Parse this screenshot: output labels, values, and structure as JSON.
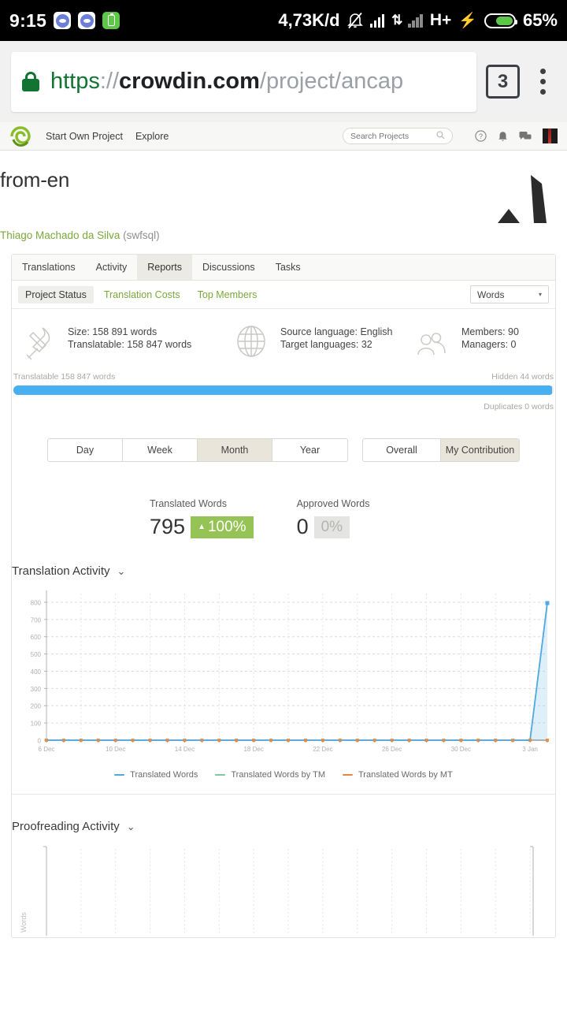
{
  "statusbar": {
    "clock": "9:15",
    "app_icons": [
      "discord-icon",
      "discord-icon",
      "battery-app-icon"
    ],
    "data_speed": "4,73K/d",
    "network_type": "H+",
    "battery_percent": "65%",
    "battery_level": 65,
    "icons": [
      "bell-muted-icon",
      "signal-icon",
      "data-transfer-icon",
      "signal-icon",
      "charging-bolt-icon"
    ]
  },
  "browser": {
    "url": {
      "scheme": "https",
      "separator": "://",
      "host": "crowdin.com",
      "path": "/project/ancap"
    },
    "lock_icon": "lock-icon",
    "tab_count": "3",
    "menu_icon": "kebab-menu-icon"
  },
  "site_header": {
    "logo": "crowdin-logo",
    "links": [
      {
        "label": "Start Own Project"
      },
      {
        "label": "Explore"
      }
    ],
    "search": {
      "placeholder": "Search Projects",
      "value": "",
      "icon": "search-icon"
    },
    "icons": [
      "help-icon",
      "bell-icon",
      "chat-icon",
      "avatar"
    ]
  },
  "project": {
    "title": "from-en",
    "owner_name": "Thiago Machado da Silva",
    "owner_handle": "(swfsql)",
    "logo": "project-logo-a"
  },
  "tabs": [
    {
      "label": "Translations",
      "active": false
    },
    {
      "label": "Activity",
      "active": false
    },
    {
      "label": "Reports",
      "active": true
    },
    {
      "label": "Discussions",
      "active": false
    },
    {
      "label": "Tasks",
      "active": false
    }
  ],
  "subtabs": [
    {
      "label": "Project Status",
      "active": true
    },
    {
      "label": "Translation Costs",
      "active": false
    },
    {
      "label": "Top Members",
      "active": false
    }
  ],
  "unit_select": {
    "value": "Words",
    "caret": "▾"
  },
  "stats": [
    {
      "icon": "tools-icon",
      "lines": [
        "Size: 158 891 words",
        "Translatable: 158 847 words"
      ]
    },
    {
      "icon": "globe-icon",
      "lines": [
        "Source language: English",
        "Target languages: 32"
      ]
    },
    {
      "icon": "members-icon",
      "lines": [
        "Members: 90",
        "Managers: 0"
      ]
    }
  ],
  "progress": {
    "left_label": "Translatable 158 847 words",
    "right_label": "Hidden 44 words",
    "percent": 99.7,
    "fill_color": "#46b0f0",
    "track_color": "#e9e9e6",
    "duplicates_label": "Duplicates 0 words"
  },
  "period_toggle": [
    {
      "label": "Day",
      "active": false
    },
    {
      "label": "Week",
      "active": false
    },
    {
      "label": "Month",
      "active": true
    },
    {
      "label": "Year",
      "active": false
    }
  ],
  "scope_toggle": [
    {
      "label": "Overall",
      "active": false
    },
    {
      "label": "My Contribution",
      "active": true
    }
  ],
  "metrics": [
    {
      "label": "Translated Words",
      "value": "795",
      "delta": "100%",
      "delta_state": "up",
      "triangle": "▲"
    },
    {
      "label": "Approved Words",
      "value": "0",
      "delta": "0%",
      "delta_state": "zero",
      "triangle": ""
    }
  ],
  "chart_data": [
    {
      "type": "area",
      "title": "Translation Activity",
      "collapse_icon": "chevron-down-icon",
      "xlabel": "",
      "ylabel": "",
      "ylim": [
        0,
        850
      ],
      "yticks": [
        0,
        100,
        200,
        300,
        400,
        500,
        600,
        700,
        800
      ],
      "grid": true,
      "legend_position": "bottom",
      "xtick_labels": [
        "6 Dec",
        "10 Dec",
        "14 Dec",
        "18 Dec",
        "22 Dec",
        "26 Dec",
        "30 Dec",
        "3 Jan"
      ],
      "x": [
        "6 Dec",
        "7 Dec",
        "8 Dec",
        "9 Dec",
        "10 Dec",
        "11 Dec",
        "12 Dec",
        "13 Dec",
        "14 Dec",
        "15 Dec",
        "16 Dec",
        "17 Dec",
        "18 Dec",
        "19 Dec",
        "20 Dec",
        "21 Dec",
        "22 Dec",
        "23 Dec",
        "24 Dec",
        "25 Dec",
        "26 Dec",
        "27 Dec",
        "28 Dec",
        "29 Dec",
        "30 Dec",
        "31 Dec",
        "1 Jan",
        "2 Jan",
        "3 Jan",
        "4 Jan"
      ],
      "series": [
        {
          "name": "Translated Words",
          "color": "#4fa8e0",
          "values": [
            0,
            0,
            0,
            0,
            0,
            0,
            0,
            0,
            0,
            0,
            0,
            0,
            0,
            0,
            0,
            0,
            0,
            0,
            0,
            0,
            0,
            0,
            0,
            0,
            0,
            0,
            0,
            0,
            0,
            795
          ]
        },
        {
          "name": "Translated Words by TM",
          "color": "#7ec89a",
          "values": [
            0,
            0,
            0,
            0,
            0,
            0,
            0,
            0,
            0,
            0,
            0,
            0,
            0,
            0,
            0,
            0,
            0,
            0,
            0,
            0,
            0,
            0,
            0,
            0,
            0,
            0,
            0,
            0,
            0,
            0
          ]
        },
        {
          "name": "Translated Words by MT",
          "color": "#e8883c",
          "values": [
            0,
            0,
            0,
            0,
            0,
            0,
            0,
            0,
            0,
            0,
            0,
            0,
            0,
            0,
            0,
            0,
            0,
            0,
            0,
            0,
            0,
            0,
            0,
            0,
            0,
            0,
            0,
            0,
            0,
            0
          ]
        }
      ]
    },
    {
      "type": "area",
      "title": "Proofreading Activity",
      "collapse_icon": "chevron-down-icon",
      "ylabel": "Words",
      "grid": true,
      "ylim": [
        0,
        850
      ],
      "x": [],
      "series": []
    }
  ]
}
